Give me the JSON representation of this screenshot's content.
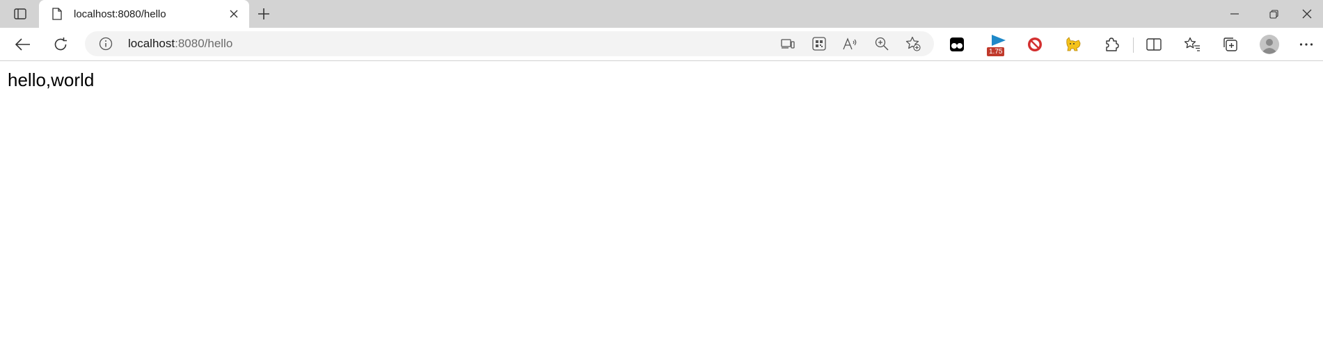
{
  "tab": {
    "title": "localhost:8080/hello"
  },
  "address": {
    "host": "localhost",
    "path": ":8080/hello"
  },
  "extensions": {
    "speed_badge": "1.75"
  },
  "page": {
    "text": "hello,world"
  },
  "colors": {
    "tabstrip": "#d3d3d3",
    "addressbar": "#f3f3f3",
    "badge": "#c0392b"
  }
}
